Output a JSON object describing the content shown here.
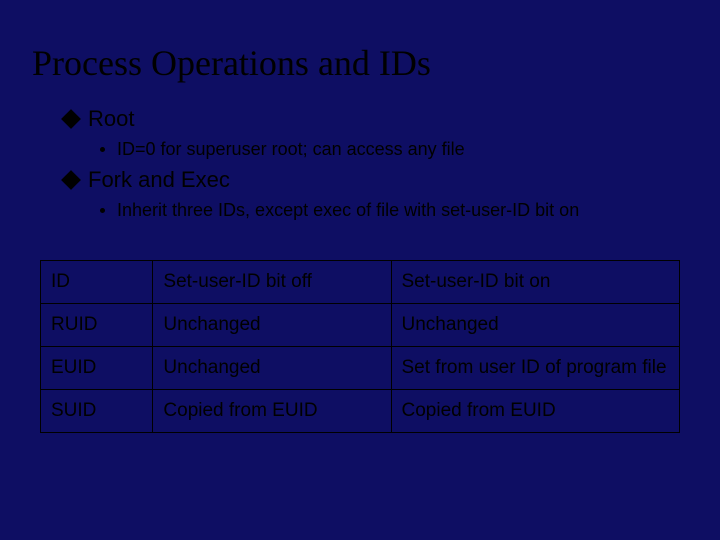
{
  "title": "Process Operations and IDs",
  "bullets": [
    {
      "level1": "Root",
      "level2": "ID=0 for superuser root; can access any file"
    },
    {
      "level1": "Fork and Exec",
      "level2": "Inherit three IDs, except exec of file with set-user-ID bit on"
    }
  ],
  "chart_data": {
    "type": "table",
    "columns": [
      "ID",
      "Set-user-ID bit off",
      "Set-user-ID bit on"
    ],
    "rows": [
      [
        "RUID",
        "Unchanged",
        "Unchanged"
      ],
      [
        "EUID",
        "Unchanged",
        "Set from user ID of program file"
      ],
      [
        "SUID",
        "Copied from EUID",
        "Copied from EUID"
      ]
    ]
  }
}
